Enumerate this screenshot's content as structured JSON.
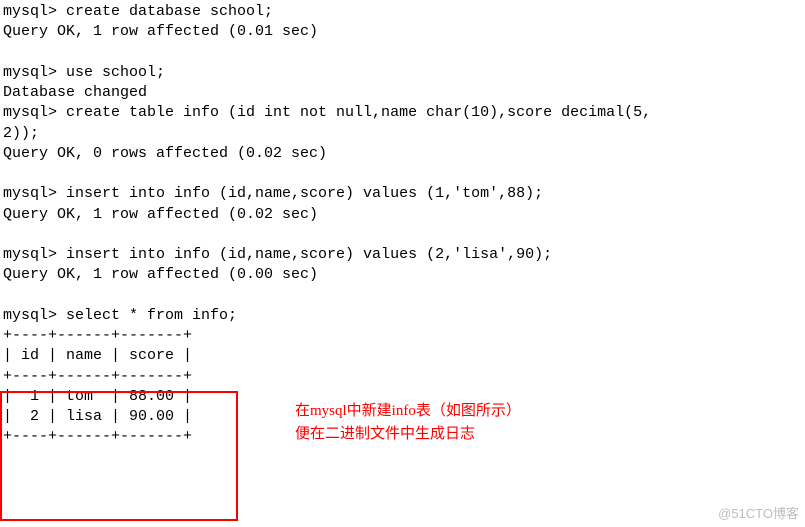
{
  "terminal": {
    "lines": [
      "mysql> create database school;",
      "Query OK, 1 row affected (0.01 sec)",
      "",
      "mysql> use school;",
      "Database changed",
      "mysql> create table info (id int not null,name char(10),score decimal(5,",
      "2));",
      "Query OK, 0 rows affected (0.02 sec)",
      "",
      "mysql> insert into info (id,name,score) values (1,'tom',88);",
      "Query OK, 1 row affected (0.02 sec)",
      "",
      "mysql> insert into info (id,name,score) values (2,'lisa',90);",
      "Query OK, 1 row affected (0.00 sec)",
      "",
      "mysql> select * from info;",
      "+----+------+-------+",
      "| id | name | score |",
      "+----+------+-------+",
      "|  1 | tom  | 88.00 |",
      "|  2 | lisa | 90.00 |",
      "+----+------+-------+"
    ]
  },
  "annotation": {
    "line1": "在mysql中新建info表（如图所示）",
    "line2": "便在二进制文件中生成日志"
  },
  "watermark": "@51CTO博客",
  "chart_data": {
    "type": "table",
    "title": "info",
    "columns": [
      "id",
      "name",
      "score"
    ],
    "rows": [
      {
        "id": 1,
        "name": "tom",
        "score": 88.0
      },
      {
        "id": 2,
        "name": "lisa",
        "score": 90.0
      }
    ]
  }
}
